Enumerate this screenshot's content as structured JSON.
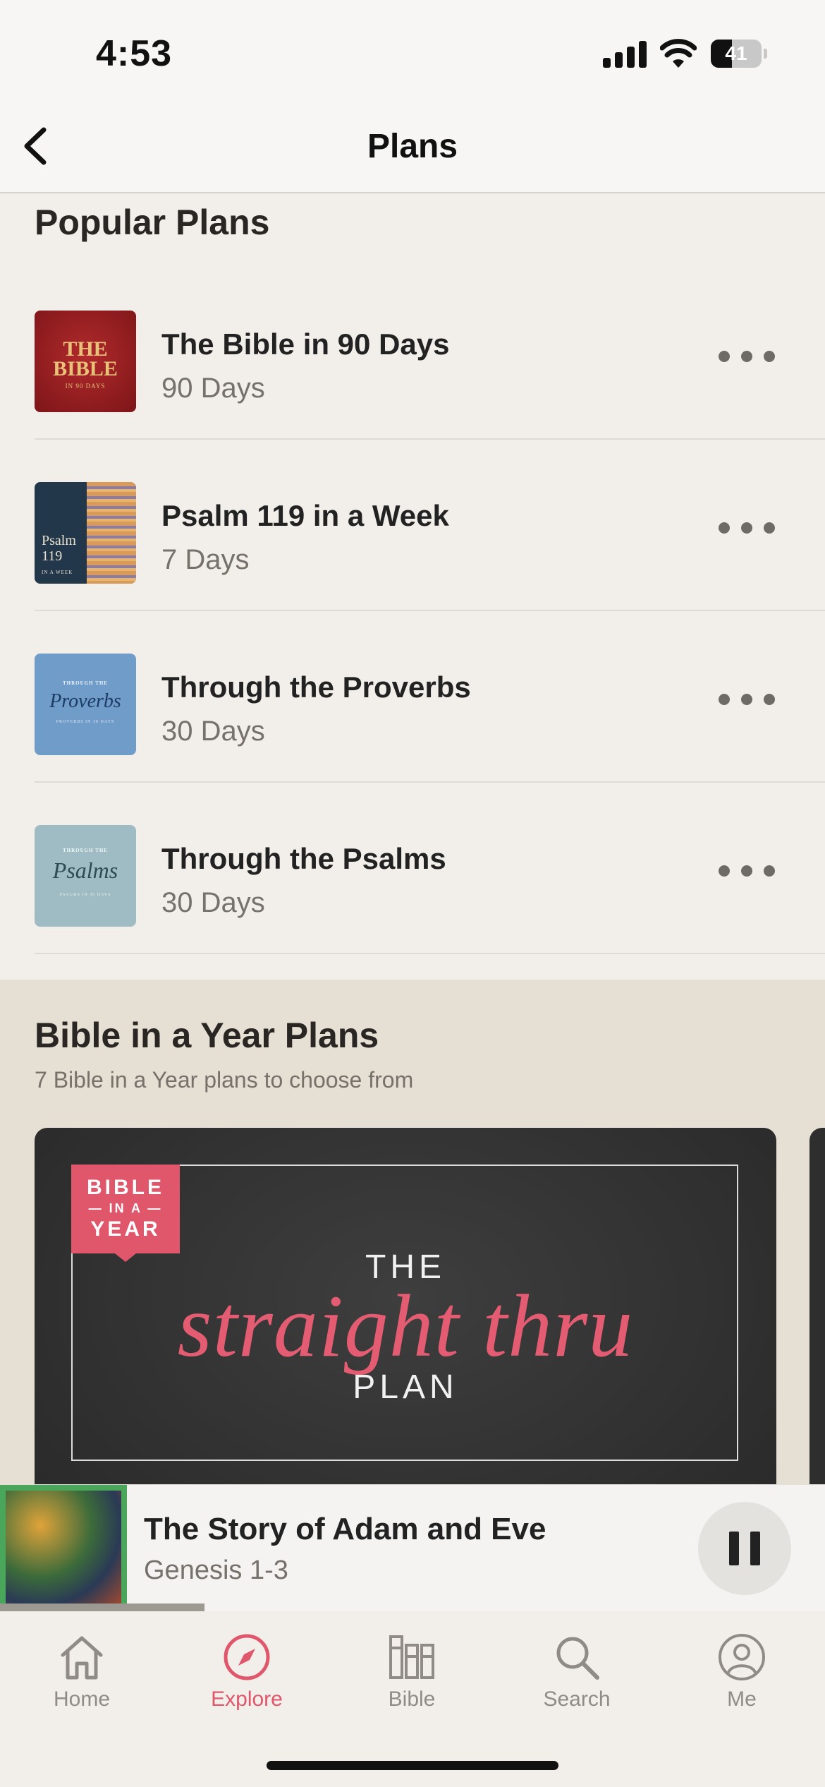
{
  "status_bar": {
    "time": "4:53",
    "battery": "41"
  },
  "nav": {
    "title": "Plans"
  },
  "popular": {
    "title": "Popular Plans",
    "plans": [
      {
        "title": "The Bible in 90 Days",
        "duration": "90 Days",
        "thumb_line1": "THE",
        "thumb_line2": "BIBLE",
        "thumb_line3": "IN 90 DAYS"
      },
      {
        "title": "Psalm 119 in a Week",
        "duration": "7 Days",
        "thumb_line1": "Psalm",
        "thumb_line2": "119",
        "thumb_line3": "IN A WEEK"
      },
      {
        "title": "Through the Proverbs",
        "duration": "30 Days",
        "thumb_line1": "THROUGH THE",
        "thumb_line2": "Proverbs",
        "thumb_line3": "PROVERBS IN 30 DAYS"
      },
      {
        "title": "Through the Psalms",
        "duration": "30 Days",
        "thumb_line1": "THROUGH THE",
        "thumb_line2": "Psalms",
        "thumb_line3": "PSALMS IN 30 DAYS"
      }
    ]
  },
  "bible_in_a_year": {
    "title": "Bible in a Year Plans",
    "subtitle": "7 Bible in a Year plans to choose from",
    "card": {
      "badge_line1": "BIBLE",
      "badge_line2": "— IN A —",
      "badge_line3": "YEAR",
      "the": "THE",
      "script": "straight thru",
      "plan": "PLAN"
    }
  },
  "now_playing": {
    "title": "The Story of Adam and Eve",
    "subtitle": "Genesis 1-3",
    "progress_fraction": 0.25
  },
  "tabs": [
    {
      "label": "Home",
      "icon": "home-icon"
    },
    {
      "label": "Explore",
      "icon": "compass-icon",
      "active": true
    },
    {
      "label": "Bible",
      "icon": "books-icon"
    },
    {
      "label": "Search",
      "icon": "search-icon"
    },
    {
      "label": "Me",
      "icon": "person-icon"
    }
  ],
  "colors": {
    "accent": "#e0566b",
    "background": "#f2efeb",
    "section_bg": "#e6dfd4"
  }
}
